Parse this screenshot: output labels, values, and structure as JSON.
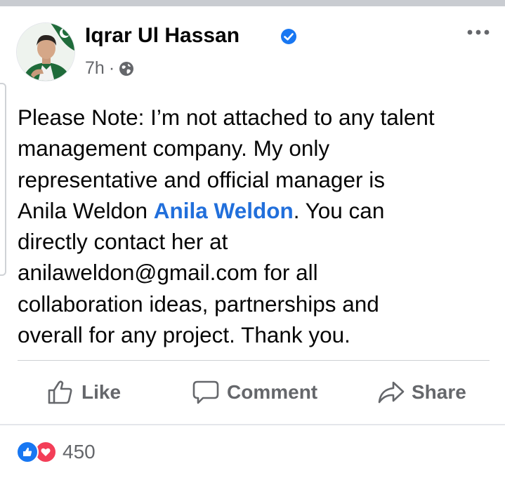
{
  "post": {
    "author": "Iqrar Ul Hassan",
    "verified": true,
    "time": "7h",
    "separator": "·",
    "audience_icon": "globe-icon",
    "menu_icon": "more-options-icon",
    "body": {
      "line_1": "Please Note:  I’m not attached to any talent",
      "line_2": "management company. My only",
      "line_3": "representative and official manager is",
      "line_4_prefix": "Anila Weldon ",
      "line_4_mention": "Anila Weldon",
      "line_4_suffix": ". You can",
      "line_5": "directly contact her at",
      "line_6": "anilaweldon@gmail.com for all",
      "line_7": "collaboration ideas, partnerships and",
      "line_8": "overall for any project. Thank you."
    }
  },
  "actions": {
    "like_label": "Like",
    "comment_label": "Comment",
    "share_label": "Share"
  },
  "reactions": {
    "types": [
      "like-reaction-icon",
      "love-reaction-icon"
    ],
    "count": "450"
  },
  "colors": {
    "mention": "#216fdb",
    "verified": "#1877f2",
    "secondary_text": "#65676b",
    "like_reaction": "#1877f2",
    "love_reaction": "#f33e58"
  }
}
